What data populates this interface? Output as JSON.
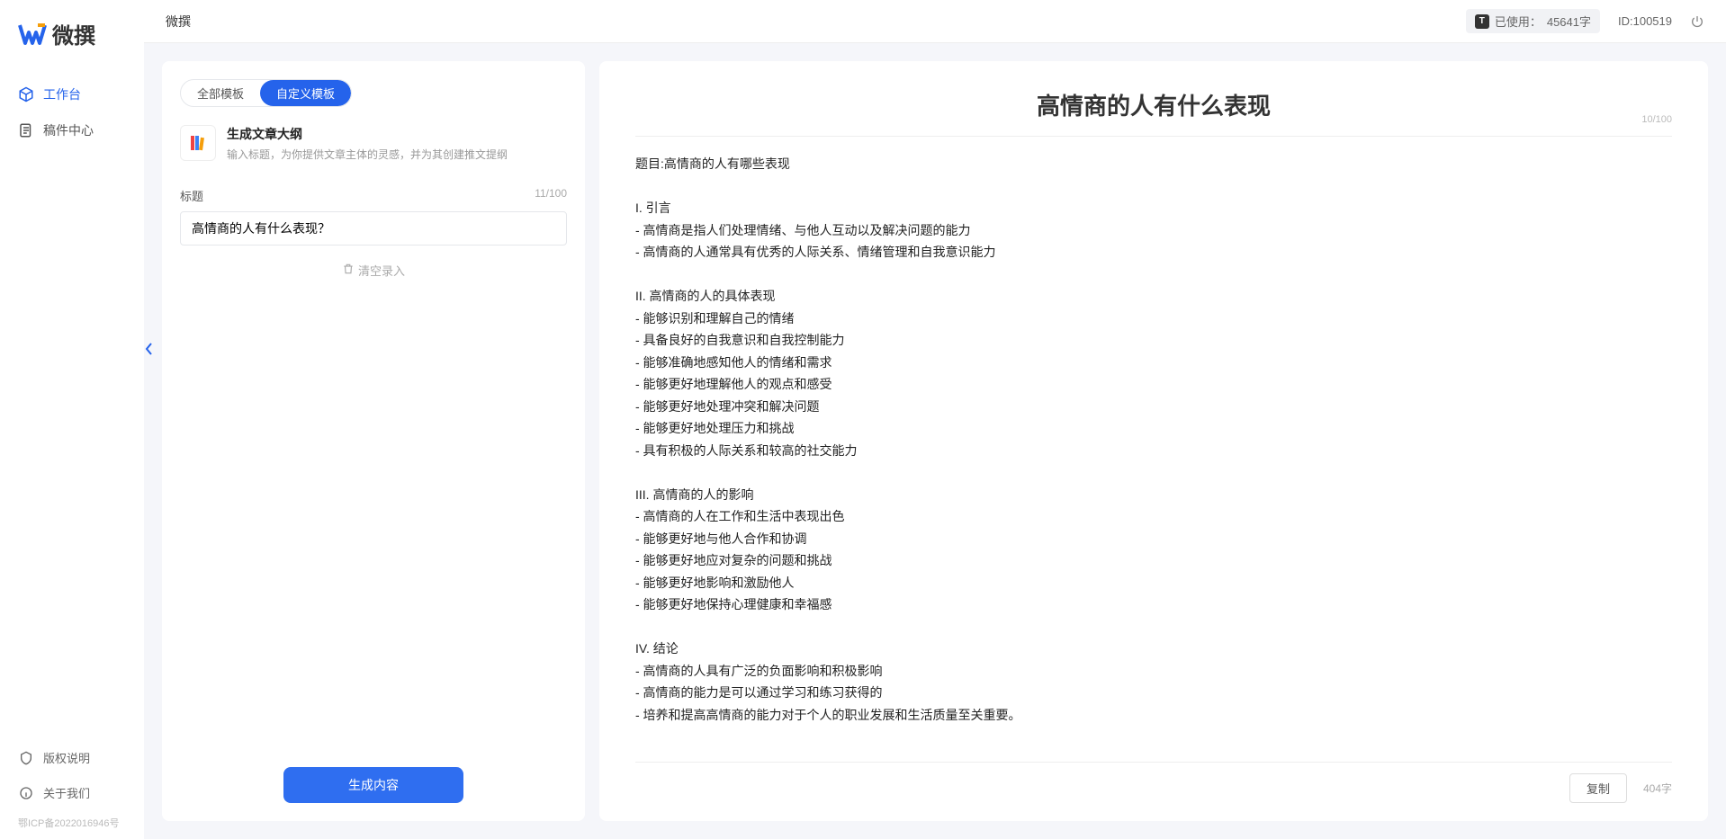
{
  "brand": {
    "name": "微撰"
  },
  "nav": {
    "workspace": "工作台",
    "drafts": "稿件中心"
  },
  "sidebar_bottom": {
    "copyright": "版权说明",
    "about": "关于我们",
    "icp": "鄂ICP备2022016946号"
  },
  "topbar": {
    "breadcrumb": "微撰",
    "usage_label": "已使用：",
    "usage_value": "45641字",
    "id_label": "ID:100519"
  },
  "tabs": {
    "all": "全部模板",
    "custom": "自定义模板"
  },
  "template": {
    "title": "生成文章大纲",
    "desc": "输入标题，为你提供文章主体的灵感，并为其创建推文提纲"
  },
  "field": {
    "label": "标题",
    "counter": "11/100",
    "value": "高情商的人有什么表现？",
    "clear": "清空录入"
  },
  "buttons": {
    "generate": "生成内容",
    "copy": "复制"
  },
  "result": {
    "title": "高情商的人有什么表现",
    "title_counter": "10/100",
    "word_count": "404字",
    "body": "题目:高情商的人有哪些表现\n\nI. 引言\n- 高情商是指人们处理情绪、与他人互动以及解决问题的能力\n- 高情商的人通常具有优秀的人际关系、情绪管理和自我意识能力\n\nII. 高情商的人的具体表现\n- 能够识别和理解自己的情绪\n- 具备良好的自我意识和自我控制能力\n- 能够准确地感知他人的情绪和需求\n- 能够更好地理解他人的观点和感受\n- 能够更好地处理冲突和解决问题\n- 能够更好地处理压力和挑战\n- 具有积极的人际关系和较高的社交能力\n\nIII. 高情商的人的影响\n- 高情商的人在工作和生活中表现出色\n- 能够更好地与他人合作和协调\n- 能够更好地应对复杂的问题和挑战\n- 能够更好地影响和激励他人\n- 能够更好地保持心理健康和幸福感\n\nIV. 结论\n- 高情商的人具有广泛的负面影响和积极影响\n- 高情商的能力是可以通过学习和练习获得的\n- 培养和提高高情商的能力对于个人的职业发展和生活质量至关重要。"
  }
}
